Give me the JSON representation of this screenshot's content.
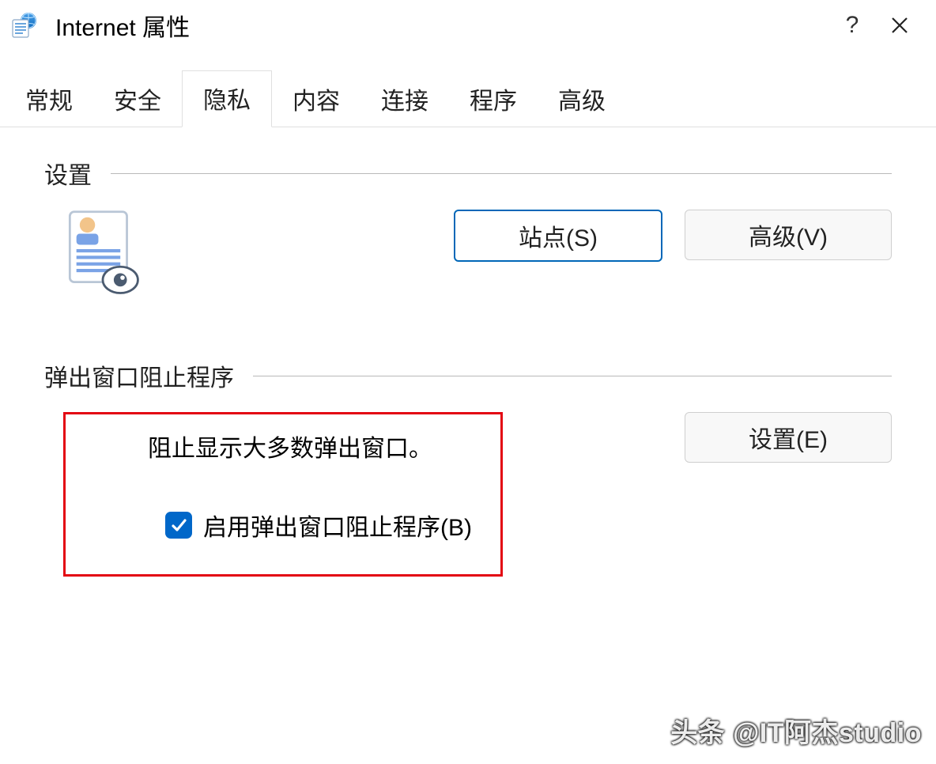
{
  "window": {
    "title": "Internet 属性"
  },
  "tabs": [
    {
      "label": "常规",
      "active": false
    },
    {
      "label": "安全",
      "active": false
    },
    {
      "label": "隐私",
      "active": true
    },
    {
      "label": "内容",
      "active": false
    },
    {
      "label": "连接",
      "active": false
    },
    {
      "label": "程序",
      "active": false
    },
    {
      "label": "高级",
      "active": false
    }
  ],
  "sections": {
    "settings": {
      "title": "设置",
      "buttons": {
        "site": "站点(S)",
        "advanced": "高级(V)"
      }
    },
    "popup": {
      "title": "弹出窗口阻止程序",
      "description": "阻止显示大多数弹出窗口。",
      "checkbox": {
        "label": "启用弹出窗口阻止程序(B)",
        "checked": true
      },
      "button": "设置(E)"
    }
  },
  "watermark": "头条 @IT阿杰studio"
}
